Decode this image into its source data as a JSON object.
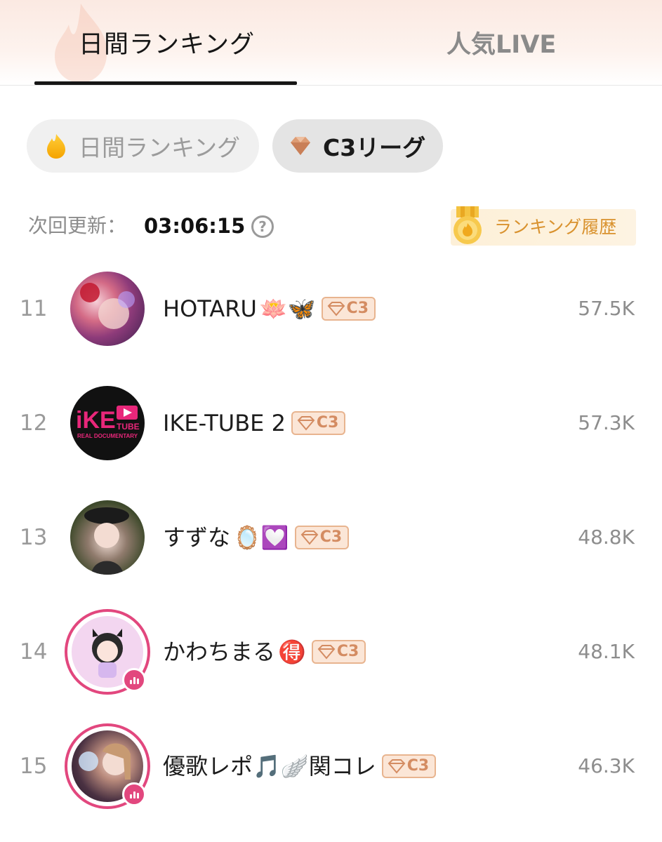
{
  "tabs": {
    "daily_label": "日間ランキング",
    "live_label": "人気LIVE"
  },
  "chips": {
    "daily_label": "日間ランキング",
    "c3_label": "C3リーグ"
  },
  "update": {
    "label": "次回更新：",
    "time": "03:06:15",
    "help_symbol": "?"
  },
  "history": {
    "label": "ランキング履歴"
  },
  "colors": {
    "accent_pink": "#e2477e",
    "badge_border": "#e8b48f",
    "badge_text": "#d48c62",
    "history_text": "#d9922e"
  },
  "rankings": [
    {
      "rank": "11",
      "name": "HOTARU",
      "emojis": "🪷🦋",
      "badge": "C3",
      "score": "57.5K",
      "live": false
    },
    {
      "rank": "12",
      "name": "IKE-TUBE 2",
      "emojis": "",
      "badge": "C3",
      "score": "57.3K",
      "live": false
    },
    {
      "rank": "13",
      "name": "すずな",
      "emojis": "🪞💟",
      "badge": "C3",
      "score": "48.8K",
      "live": false
    },
    {
      "rank": "14",
      "name": "かわちまる",
      "emojis": "🉐",
      "badge": "C3",
      "score": "48.1K",
      "live": true
    },
    {
      "rank": "15",
      "name": "優歌レポ🎵🪽関コレ",
      "emojis": "",
      "badge": "C3",
      "score": "46.3K",
      "live": true
    }
  ],
  "avatar_logo_text": {
    "ike": "iKE",
    "tube": "TUBE",
    "sub": "REAL DOCUMENTARY"
  }
}
